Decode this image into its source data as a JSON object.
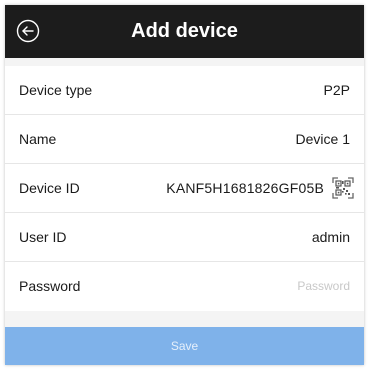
{
  "header": {
    "title": "Add device",
    "back_icon": "back-arrow-circle-icon"
  },
  "form": {
    "device_type": {
      "label": "Device type",
      "value": "P2P"
    },
    "name": {
      "label": "Name",
      "value": "Device 1"
    },
    "device_id": {
      "label": "Device ID",
      "value": "KANF5H1681826GF05B",
      "scan_icon": "qr-code-scan-icon"
    },
    "user_id": {
      "label": "User ID",
      "value": "admin"
    },
    "password": {
      "label": "Password",
      "value": "",
      "placeholder": "Password"
    }
  },
  "save_label": "Save",
  "colors": {
    "header_bg": "#1c1c1c",
    "page_bg": "#f4f4f4",
    "save_bg": "#7fb2ea"
  }
}
